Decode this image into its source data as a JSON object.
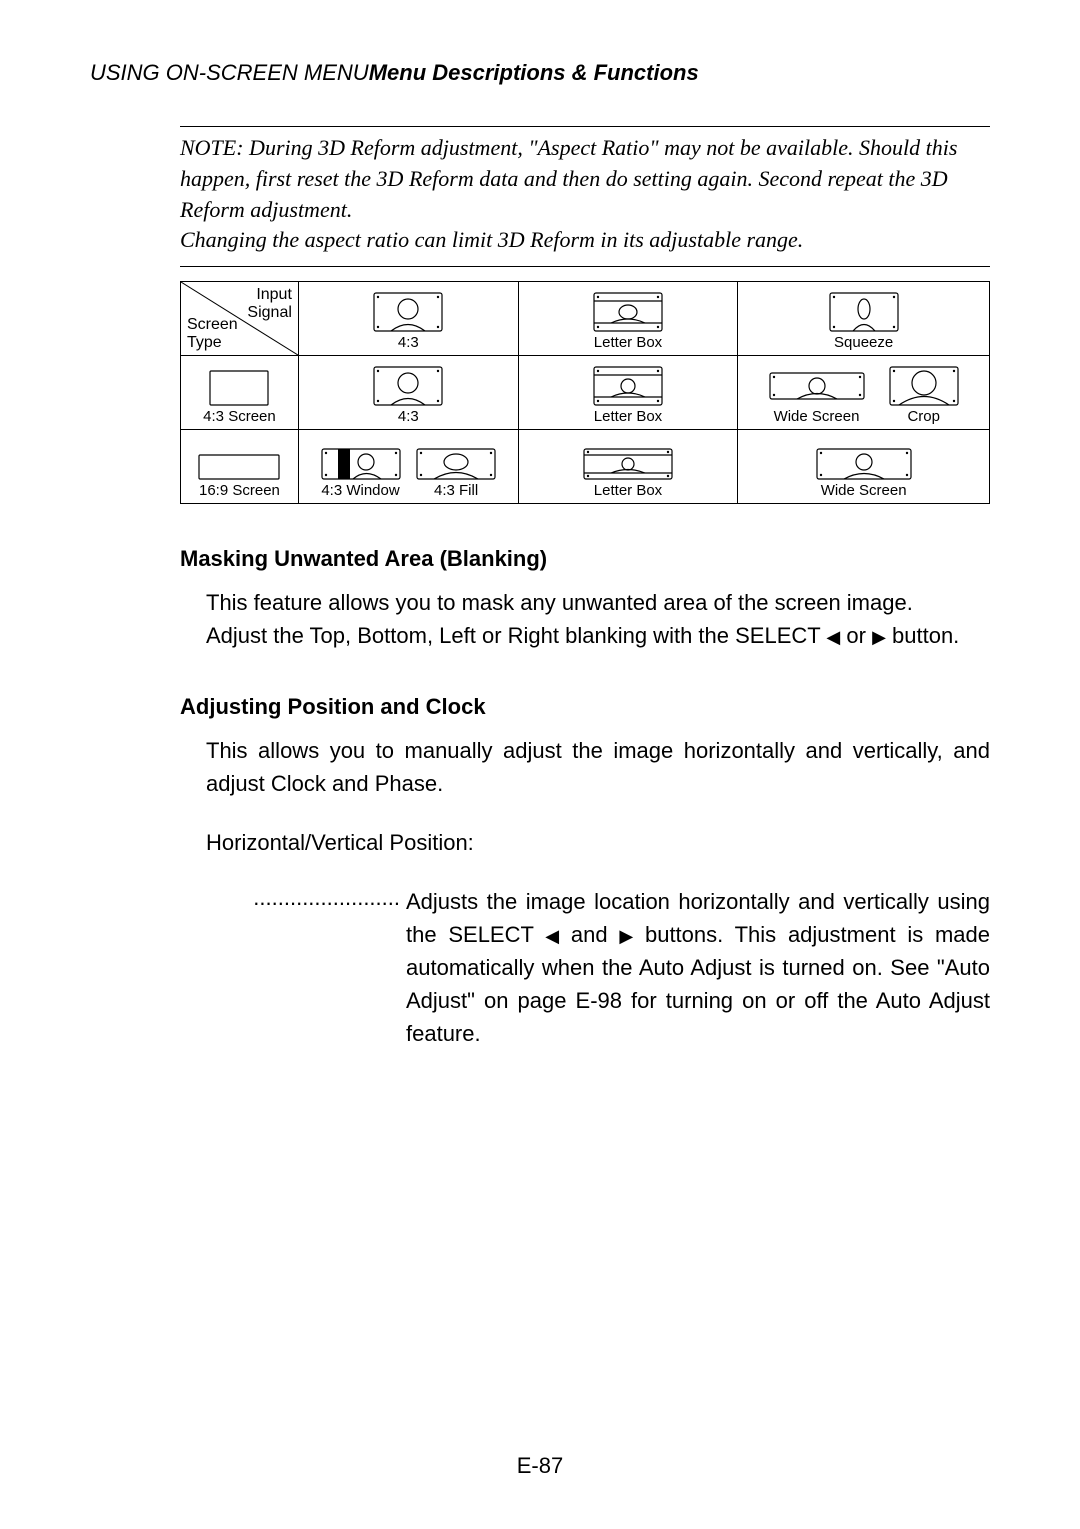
{
  "header": {
    "prefix": "USING ON-SCREEN MENU",
    "suffix": "Menu Descriptions & Functions"
  },
  "note": {
    "line1": "NOTE: During 3D Reform adjustment, \"Aspect Ratio\" may not be available. Should this happen, first reset the 3D Reform data and then do setting again. Second repeat the 3D Reform adjustment.",
    "line2": "Changing the aspect ratio can limit 3D Reform in its adjustable range."
  },
  "table": {
    "hdr_top": "Input\nSignal",
    "hdr_bottom": "Screen\nType",
    "col_headers": [
      "4:3",
      "Letter Box",
      "Squeeze"
    ],
    "rows": [
      {
        "label": "4:3 Screen",
        "cells": [
          "4:3",
          "Letter Box",
          [
            "Wide Screen",
            "Crop"
          ]
        ]
      },
      {
        "label": "16:9 Screen",
        "cells": [
          [
            "4:3 Window",
            "4:3 Fill"
          ],
          "Letter Box",
          "Wide Screen"
        ]
      }
    ]
  },
  "sections": {
    "blanking": {
      "title": "Masking Unwanted Area (Blanking)",
      "p1": "This feature allows you to mask any unwanted area of the screen image.",
      "p2_a": "Adjust the Top, Bottom, Left or Right blanking with the SELECT ",
      "p2_b": " or ",
      "p2_c": " button."
    },
    "position": {
      "title": "Adjusting Position and Clock",
      "p1": "This allows you to manually adjust the image horizontally and vertically, and adjust Clock and Phase.",
      "sub": "Horizontal/Vertical Position:",
      "dots": "........................",
      "desc_a": "Adjusts the image location horizontally and vertically using the SELECT ",
      "desc_b": " and ",
      "desc_c": " buttons. This adjustment is made automatically when the Auto Adjust is turned on. See \"Auto Adjust\" on page E-98 for turning on or off the Auto Adjust feature."
    }
  },
  "page_number": "E-87",
  "glyphs": {
    "left": "◀",
    "right": "▶"
  }
}
